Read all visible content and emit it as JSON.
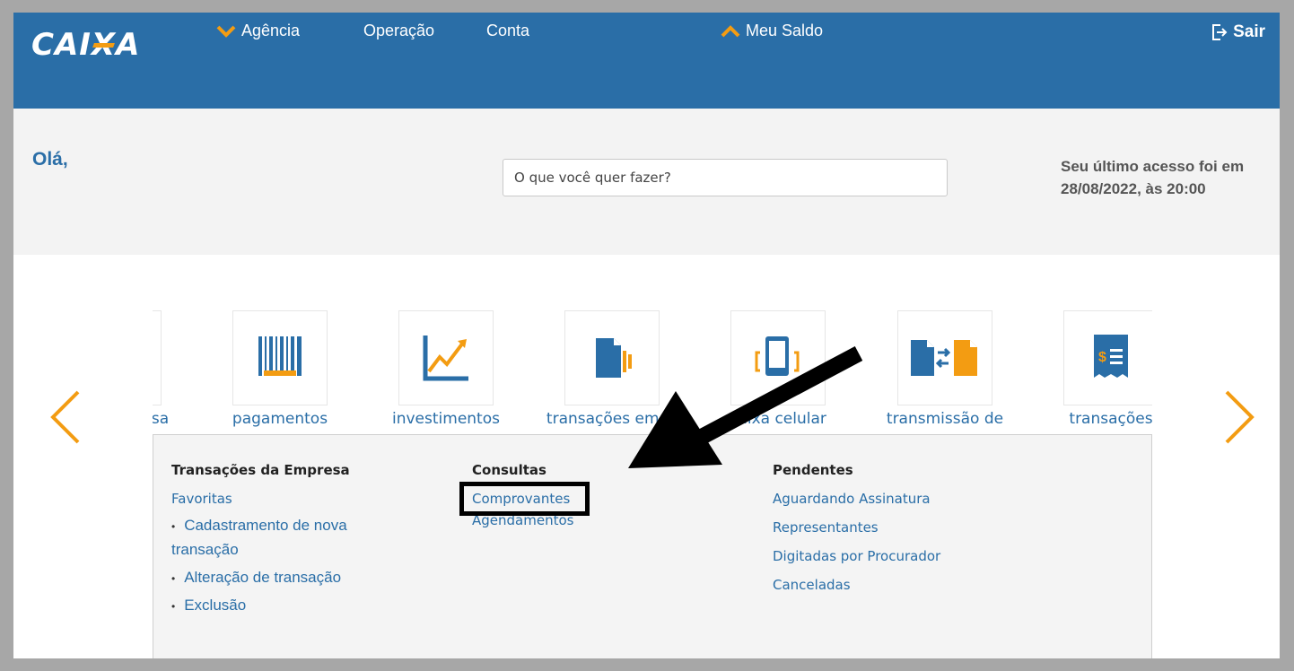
{
  "header": {
    "logo": "CAIXA",
    "nav": [
      {
        "label": "Agência",
        "icon": "chevron-down-icon"
      },
      {
        "label": "Operação"
      },
      {
        "label": "Conta"
      },
      {
        "label": "Meu Saldo",
        "icon": "chevron-up-icon"
      }
    ],
    "logout_label": "Sair",
    "logout_icon": "logout-icon"
  },
  "greeting": {
    "hello": "Olá,",
    "search_placeholder": "O que você quer fazer?",
    "last_access_line1": "Seu último acesso foi em",
    "last_access_line2": "28/08/2022, às 20:00"
  },
  "carousel": {
    "items": [
      {
        "label": "Transações da Empresa",
        "visible_label": "resa",
        "icon": "building-icon"
      },
      {
        "label": "pagamentos",
        "icon": "barcode-icon"
      },
      {
        "label": "investimentos",
        "icon": "growth-chart-icon"
      },
      {
        "label": "transações em lo",
        "icon": "document-batch-icon"
      },
      {
        "label": "caixa celular",
        "icon": "mobile-phone-icon"
      },
      {
        "label": "transmissão de",
        "icon": "file-transfer-icon"
      },
      {
        "label": "transações",
        "icon": "receipt-icon"
      }
    ],
    "prev_icon": "chevron-left-icon",
    "next_icon": "chevron-right-icon"
  },
  "menu": {
    "col1": {
      "title": "Transações da Empresa",
      "favorites": "Favoritas",
      "items": [
        "Cadastramento de nova",
        "transação",
        "Alteração de transação",
        "Exclusão"
      ],
      "bullet": "•"
    },
    "col2": {
      "title": "Consultas",
      "items": [
        "Comprovantes",
        "Agendamentos"
      ]
    },
    "col3": {
      "title": "Pendentes",
      "items": [
        "Aguardando Assinatura",
        "Representantes",
        "Digitadas por Procurador",
        "Canceladas"
      ]
    }
  },
  "colors": {
    "brand_blue": "#2a6ea7",
    "brand_orange": "#f39c12",
    "annotation": "#000000"
  }
}
